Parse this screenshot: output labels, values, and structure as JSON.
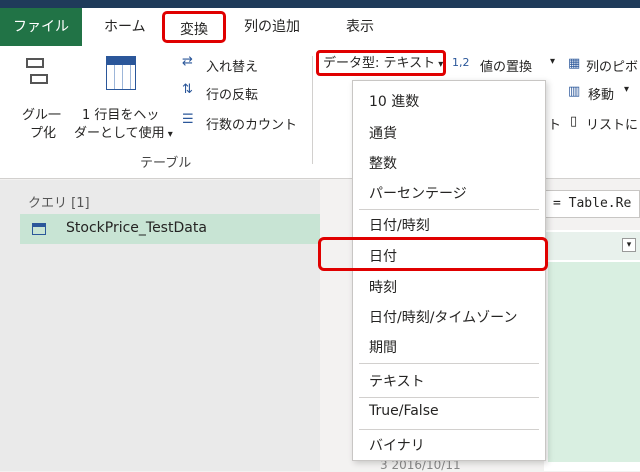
{
  "tabs": {
    "file": "ファイル",
    "home": "ホーム",
    "transform": "変換",
    "add_column": "列の追加",
    "view": "表示"
  },
  "ribbon": {
    "group": "グループ",
    "group_line1": "グル一",
    "group_line2": "プ化",
    "use_first_row_line1": "1 行目をヘッ",
    "use_first_row_line2": "ダーとして使用",
    "transpose": "入れ替え",
    "reverse_rows": "行の反転",
    "count_rows": "行数のカウント",
    "table_group_label": "テーブル",
    "data_type": "データ型: テキスト",
    "replace_values": "値の置換",
    "replace_values_prefix": "1,2",
    "column_pivot": "列のピボ",
    "move": "移動",
    "to_list": "リストに"
  },
  "queries": {
    "header": "クエリ [1]",
    "items": [
      "StockPrice_TestData"
    ]
  },
  "formula": {
    "text": "= Table.Re"
  },
  "datatype_menu": {
    "items": [
      "10 進数",
      "通貨",
      "整数",
      "パーセンテージ",
      "日付/時刻",
      "日付",
      "時刻",
      "日付/時刻/タイムゾーン",
      "期間",
      "テキスト",
      "True/False",
      "バイナリ"
    ],
    "selected": "日付"
  },
  "grid": {
    "bottom_text": "3   2016/10/11"
  }
}
